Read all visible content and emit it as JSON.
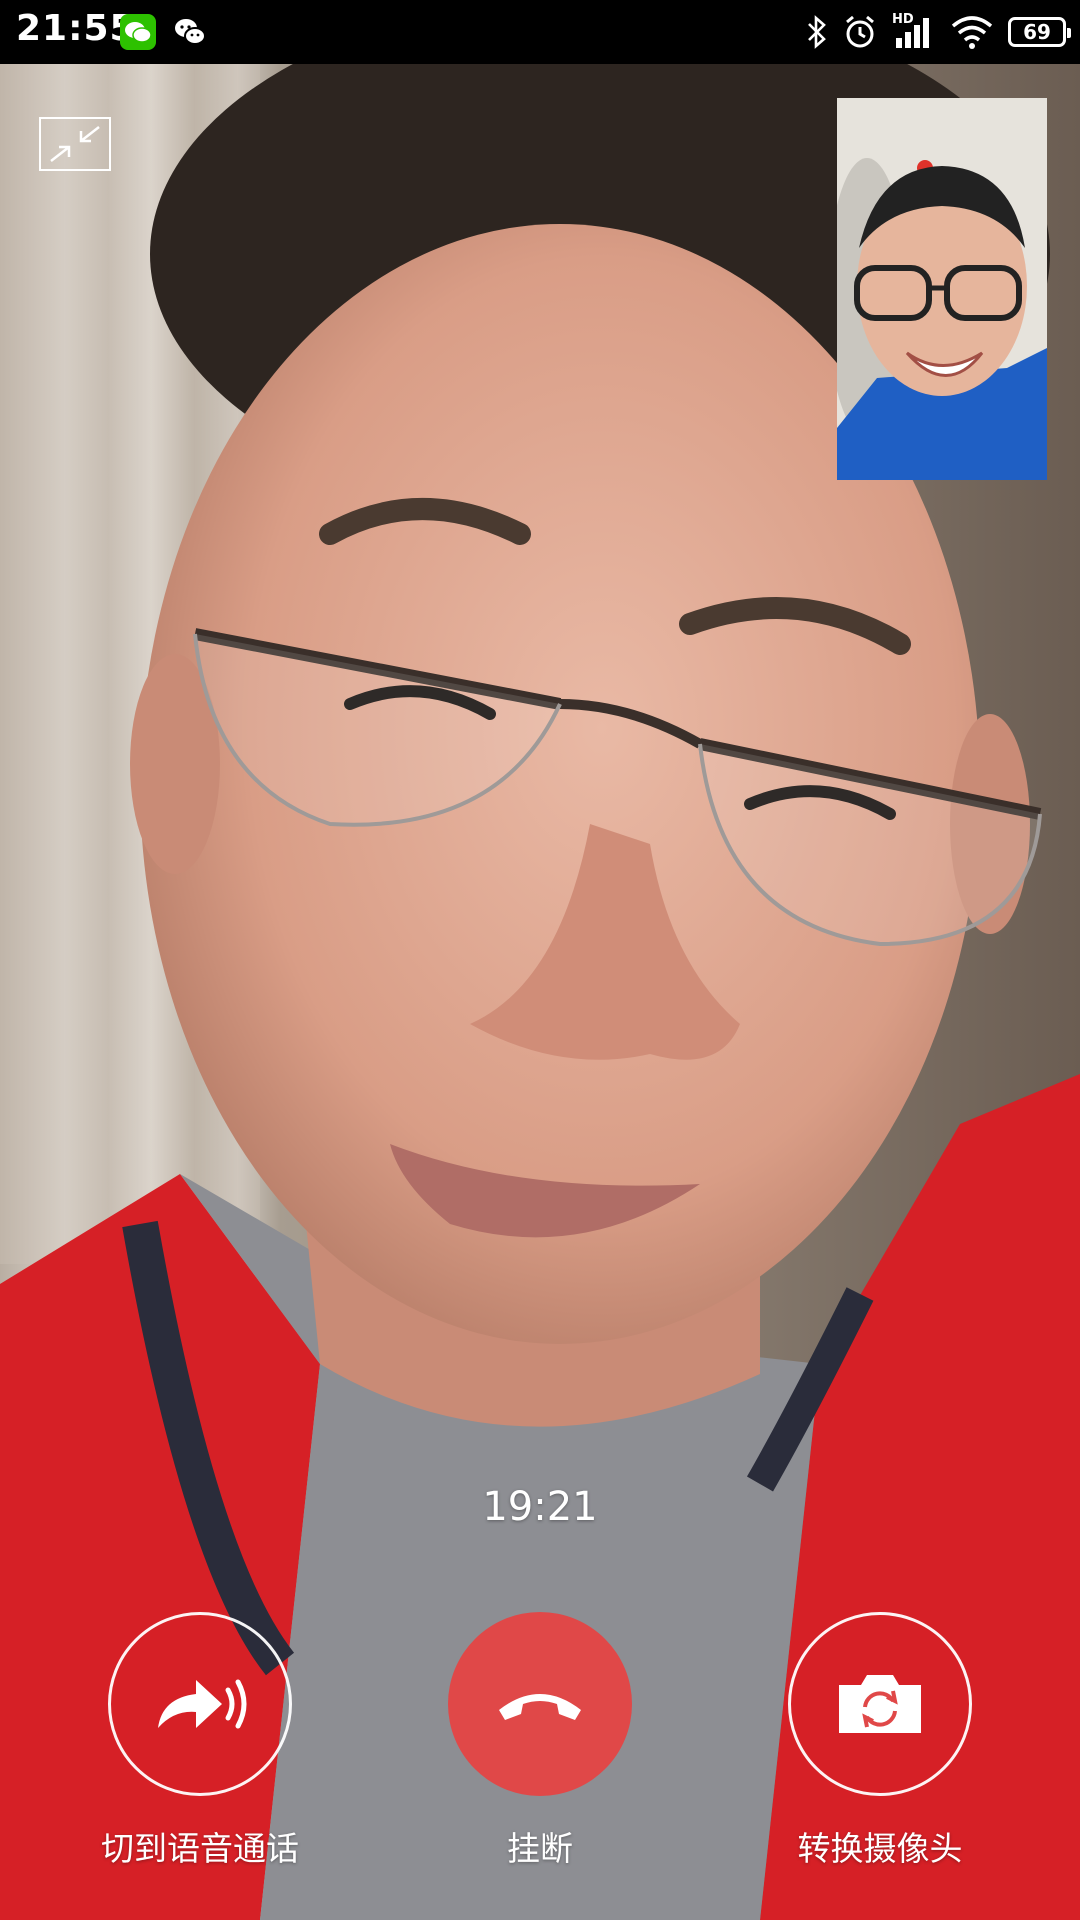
{
  "status_bar": {
    "time": "21:55",
    "notification_icons": [
      "wechat-icon",
      "wechat-outline-icon"
    ],
    "system_icons": [
      "bluetooth-icon",
      "alarm-icon",
      "hd-signal-icon",
      "wifi-icon",
      "battery-icon"
    ],
    "network_badge": "HD",
    "battery_level": "69"
  },
  "call": {
    "timer": "19:21",
    "controls": {
      "switch_to_voice_label": "切到语音通话",
      "hang_up_label": "挂断",
      "switch_camera_label": "转换摄像头"
    }
  },
  "colors": {
    "hangup_red": "#e04848",
    "jacket_red": "#d62026",
    "status_bar_bg": "#000000"
  }
}
